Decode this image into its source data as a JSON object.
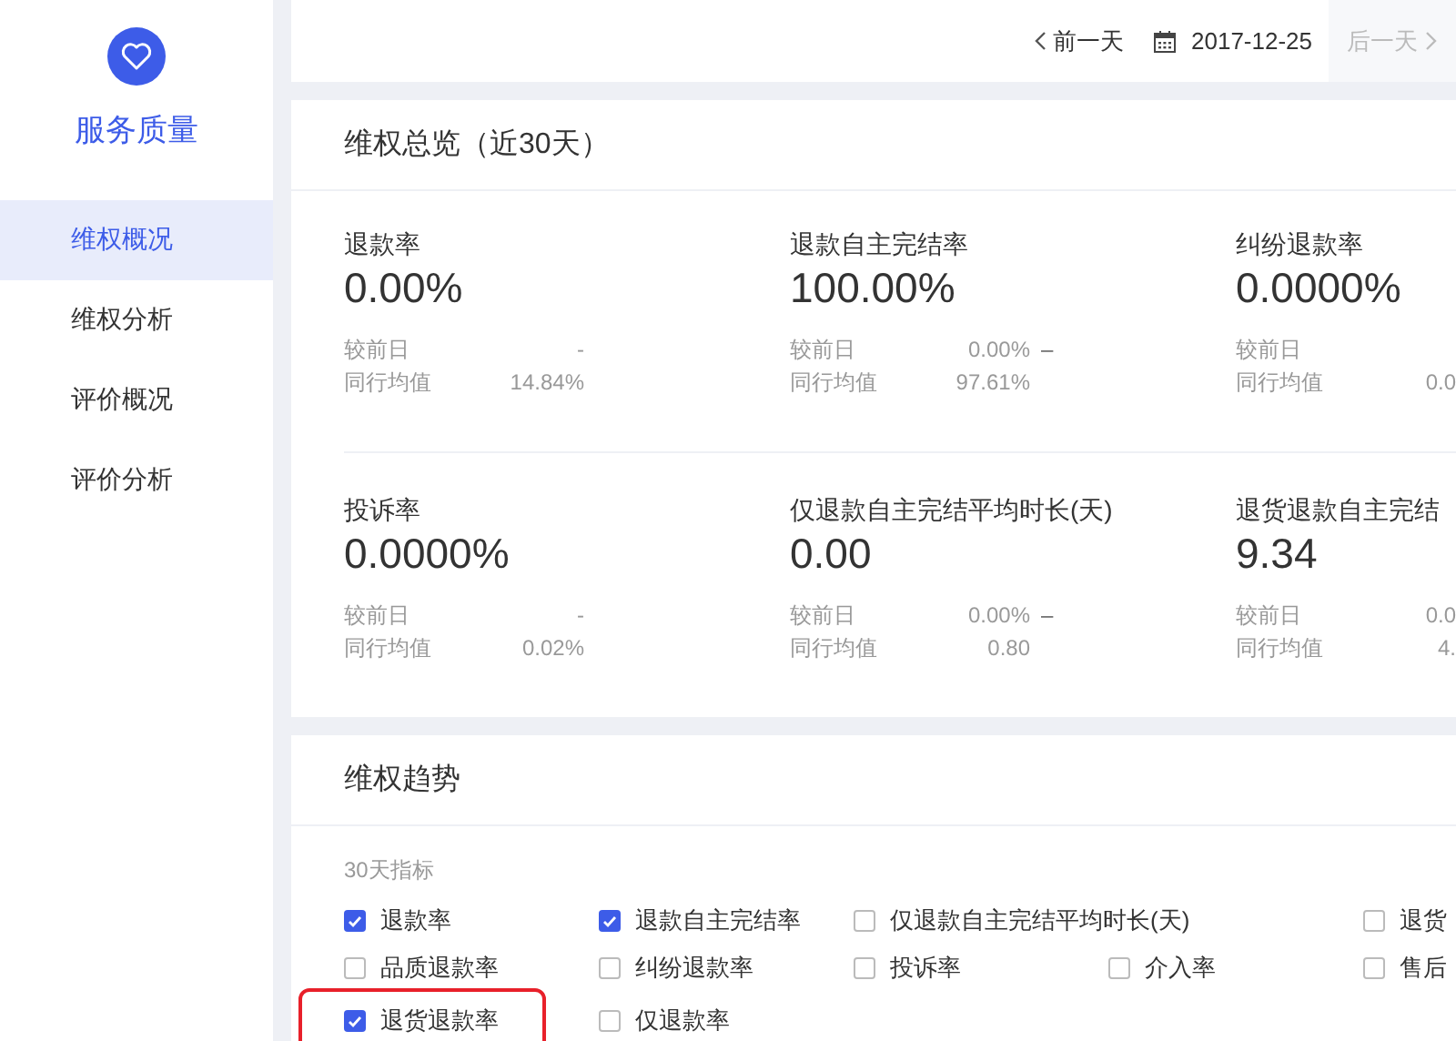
{
  "sidebar": {
    "title": "服务质量",
    "items": [
      {
        "label": "维权概况",
        "selected": true
      },
      {
        "label": "维权分析",
        "selected": false
      },
      {
        "label": "评价概况",
        "selected": false
      },
      {
        "label": "评价分析",
        "selected": false
      }
    ]
  },
  "date_nav": {
    "prev": "前一天",
    "date": "2017-12-25",
    "next": "后一天",
    "next_disabled": true
  },
  "overview": {
    "title": "维权总览（近30天）",
    "metrics": [
      {
        "name": "退款率",
        "value": "0.00%",
        "compare_label": "较前日",
        "compare": "-",
        "peer_label": "同行均值",
        "peer": "14.84%"
      },
      {
        "name": "退款自主完结率",
        "value": "100.00%",
        "compare_label": "较前日",
        "compare": "0.00%",
        "trend": "–",
        "peer_label": "同行均值",
        "peer": "97.61%"
      },
      {
        "name": "纠纷退款率",
        "value": "0.0000%",
        "compare_label": "较前日",
        "peer_label": "同行均值",
        "peer": "0.0"
      },
      {
        "name": "投诉率",
        "value": "0.0000%",
        "compare_label": "较前日",
        "compare": "-",
        "peer_label": "同行均值",
        "peer": "0.02%"
      },
      {
        "name": "仅退款自主完结平均时长(天)",
        "value": "0.00",
        "compare_label": "较前日",
        "compare": "0.00%",
        "trend": "–",
        "peer_label": "同行均值",
        "peer": "0.80"
      },
      {
        "name": "退货退款自主完结",
        "value": "9.34",
        "compare_label": "较前日",
        "compare": "0.0",
        "peer_label": "同行均值",
        "peer": "4."
      }
    ]
  },
  "trend": {
    "title": "维权趋势",
    "group_label": "30天指标",
    "rows": [
      [
        {
          "label": "退款率",
          "checked": true,
          "kind": "normal",
          "highlighted": false
        },
        {
          "label": "退款自主完结率",
          "checked": true,
          "kind": "normal",
          "highlighted": false
        },
        {
          "label": "仅退款自主完结平均时长(天)",
          "checked": false,
          "kind": "normal",
          "highlighted": false
        },
        "",
        {
          "label": "退货",
          "checked": false,
          "kind": "normal",
          "highlighted": false
        }
      ],
      [
        {
          "label": "品质退款率",
          "checked": false,
          "kind": "normal",
          "highlighted": false
        },
        {
          "label": "纠纷退款率",
          "checked": false,
          "kind": "normal",
          "highlighted": false
        },
        {
          "label": "投诉率",
          "checked": false,
          "kind": "normal",
          "highlighted": false
        },
        {
          "label": "介入率",
          "checked": false,
          "kind": "normal",
          "highlighted": false
        },
        {
          "label": "售后",
          "checked": false,
          "kind": "normal",
          "highlighted": false
        }
      ],
      [
        {
          "label": "退货退款率",
          "checked": true,
          "kind": "normal",
          "highlighted": true
        },
        {
          "label": "仅退款率",
          "checked": false,
          "kind": "normal",
          "highlighted": false
        }
      ]
    ]
  }
}
